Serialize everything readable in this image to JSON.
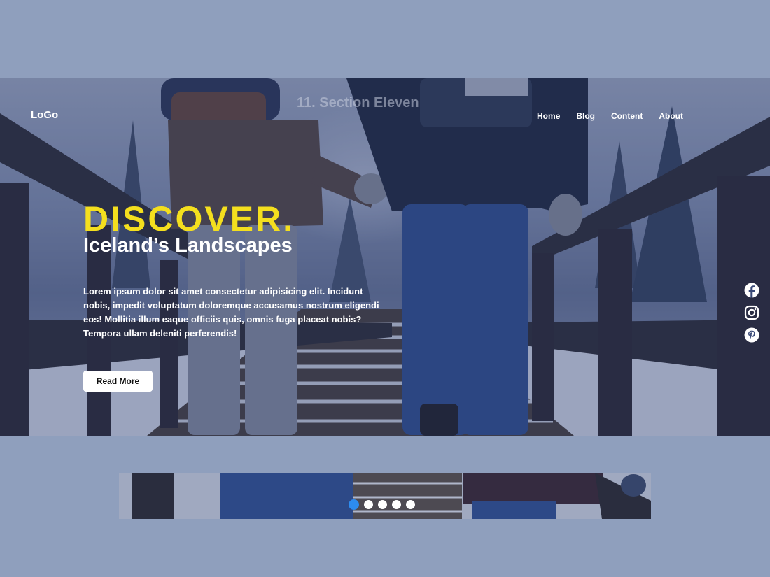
{
  "brand": {
    "logo_text": "LoGo"
  },
  "section": {
    "title": "11. Section Eleven"
  },
  "nav": {
    "items": [
      "Home",
      "Blog",
      "Content",
      "About"
    ]
  },
  "hero": {
    "headline": "DISCOVER.",
    "subheadline": "Iceland’s Landscapes",
    "body": "Lorem ipsum dolor sit amet consectetur adipisicing elit. Incidunt nobis, impedit voluptatum doloremque accusamus nostrum eligendi eos! Mollitia illum eaque officiis quis, omnis fuga placeat nobis? Tempora ullam deleniti perferendis!",
    "cta_label": "Read More",
    "image": "couple-walking-on-snowy-wooden-bridge-photo"
  },
  "socials": {
    "icons": [
      "facebook-icon",
      "instagram-icon",
      "pinterest-icon"
    ]
  },
  "slider": {
    "slide_count": 5,
    "active_slide": 1,
    "thumbnail": "snowy-bridge-thumbnail-photo"
  },
  "colors": {
    "page_background": "#8f9fbd",
    "headline": "#f4df1e",
    "overlay": "#28376e",
    "active_dot": "#2d8cf0",
    "button_bg": "#ffffff"
  }
}
